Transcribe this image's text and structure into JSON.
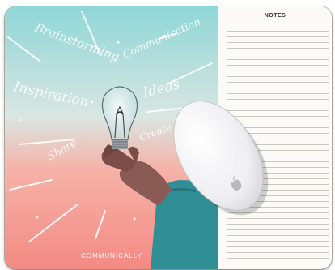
{
  "image": {
    "description_tag": "mousepad-product-photo"
  },
  "artwork": {
    "colors": {
      "top": "#8fd6d7",
      "middle": "#d7e3e0",
      "bottom": "#f38a83",
      "sleeve": "#2f8f95",
      "skin": "#8a5a55"
    },
    "words": [
      {
        "text": "Brainstorming"
      },
      {
        "text": "Communication"
      },
      {
        "text": "Inspiration"
      },
      {
        "text": "Ideas"
      },
      {
        "text": "Create"
      },
      {
        "text": "Share"
      }
    ],
    "brand": "COMMUNICALLY"
  },
  "notes": {
    "title": "NOTES"
  },
  "mouse": {
    "color": "#f3f3f5",
    "icon": "apple-logo-icon"
  }
}
